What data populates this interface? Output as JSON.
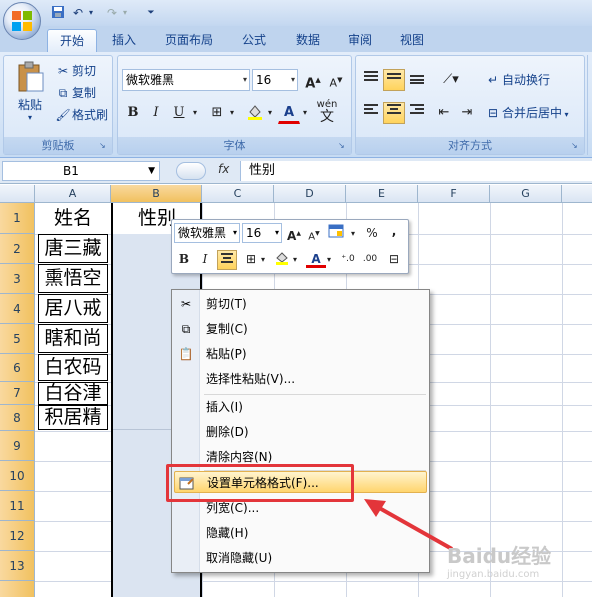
{
  "ribbon": {
    "tabs": [
      "开始",
      "插入",
      "页面布局",
      "公式",
      "数据",
      "审阅",
      "视图"
    ],
    "active_tab": "开始",
    "clipboard": {
      "paste_label": "粘贴",
      "cut_label": "剪切",
      "copy_label": "复制",
      "format_painter_label": "格式刷",
      "group_label": "剪贴板"
    },
    "font": {
      "font_name": "微软雅黑",
      "font_size": "16",
      "group_label": "字体",
      "bold": "B",
      "italic": "I",
      "underline": "U",
      "pinyin_label": "wén"
    },
    "alignment": {
      "wrap_text_label": "自动换行",
      "merge_center_label": "合并后居中",
      "group_label": "对齐方式"
    }
  },
  "formula_bar": {
    "name_box": "B1",
    "fx": "fx",
    "formula": "性别"
  },
  "grid": {
    "columns": [
      "A",
      "B",
      "C",
      "D",
      "E",
      "F",
      "G"
    ],
    "selected_column": "B",
    "rows": [
      "1",
      "2",
      "3",
      "4",
      "5",
      "6",
      "7",
      "8",
      "9",
      "10",
      "11",
      "12",
      "13"
    ],
    "header_a": "姓名",
    "header_b": "性别",
    "names": [
      "唐三藏",
      "熏悟空",
      "居八戒",
      "瞎和尚",
      "白农码",
      "白谷津",
      "积居精"
    ]
  },
  "mini_toolbar": {
    "font_name": "微软雅黑",
    "font_size": "16",
    "percent": "%",
    "comma": ","
  },
  "context_menu": {
    "items": [
      "剪切(T)",
      "复制(C)",
      "粘贴(P)",
      "选择性粘贴(V)...",
      "插入(I)",
      "删除(D)",
      "清除内容(N)",
      "设置单元格格式(F)...",
      "列宽(C)...",
      "隐藏(H)",
      "取消隐藏(U)"
    ],
    "highlighted_index": 7
  },
  "watermark": {
    "text": "Baidu经验",
    "subtext": "jingyan.baidu.com"
  },
  "colors": {
    "accent_red": "#e3353a",
    "selection_fill": "#dbe4f1",
    "highlight": "#ffd56e"
  }
}
